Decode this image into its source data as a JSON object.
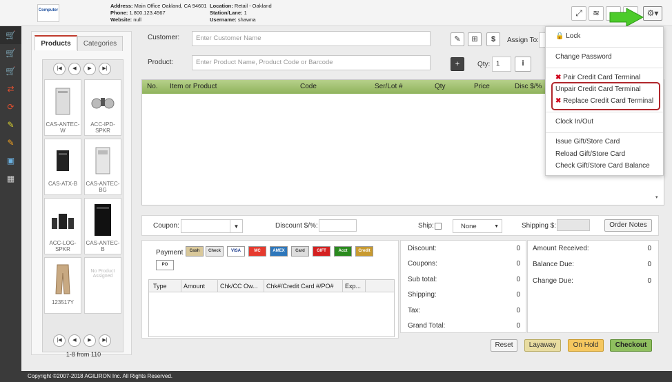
{
  "header": {
    "logo_text": "Computer",
    "address_label": "Address:",
    "address": "Main Office Oakland, CA 94601",
    "phone_label": "Phone:",
    "phone": "1.800.123.4567",
    "website_label": "Website:",
    "website": "null",
    "location_label": "Location:",
    "location": "Retail - Oakland",
    "station_label": "Station/Lane:",
    "station": "1",
    "username_label": "Username:",
    "username": "shawna"
  },
  "products_panel": {
    "tabs": [
      "Products",
      "Categories"
    ],
    "products": [
      {
        "name": "CAS-ANTEC-W"
      },
      {
        "name": "ACC-IPD-SPKR"
      },
      {
        "name": "CAS-ATX-B"
      },
      {
        "name": "CAS-ANTEC-BG"
      },
      {
        "name": "ACC-LOG-SPKR"
      },
      {
        "name": "CAS-ANTEC-B"
      },
      {
        "name": "123517Y"
      },
      {
        "name": "No Product Assigned"
      }
    ],
    "pagination_text": "1-8 from 110"
  },
  "order": {
    "customer_label": "Customer:",
    "customer_placeholder": "Enter Customer Name",
    "assign_to_label": "Assign To:",
    "product_label": "Product:",
    "product_placeholder": "Enter Product Name, Product Code or Barcode",
    "qty_label": "Qty:",
    "qty_value": "1",
    "columns": [
      "No.",
      "Item or Product",
      "Code",
      "Ser/Lot #",
      "Qty",
      "Price",
      "Disc $/%"
    ]
  },
  "options_bar": {
    "coupon_label": "Coupon:",
    "disc_label": "Discount $/%:",
    "ship_label": "Ship:",
    "ship_select": "None",
    "shipping_label": "Shipping $:",
    "order_notes": "Order Notes"
  },
  "payment": {
    "label": "Payment",
    "icons": [
      "Cash",
      "Check",
      "VISA",
      "MC",
      "AMEX",
      "Card",
      "GIFT",
      "Acct",
      "Credit",
      "PO"
    ],
    "columns": [
      "Type",
      "Amount",
      "Chk/CC Ow...",
      "Chk#/Credit Card #/PO#",
      "Exp..."
    ]
  },
  "totals": {
    "rows": [
      {
        "label": "Discount:",
        "value": "0"
      },
      {
        "label": "Coupons:",
        "value": "0"
      },
      {
        "label": "Sub total:",
        "value": "0"
      },
      {
        "label": "Shipping:",
        "value": "0"
      },
      {
        "label": "Tax:",
        "value": "0"
      },
      {
        "label": "Grand Total:",
        "value": "0"
      }
    ]
  },
  "balance": {
    "rows": [
      {
        "label": "Amount Received:",
        "value": "0"
      },
      {
        "label": "Balance Due:",
        "value": "0"
      },
      {
        "label": "Change Due:",
        "value": "0"
      }
    ]
  },
  "actions": {
    "reset": "Reset",
    "layaway": "Layaway",
    "on_hold": "On Hold",
    "checkout": "Checkout"
  },
  "settings_menu": {
    "lock": "Lock",
    "change_password": "Change Password",
    "pair_terminal": "Pair Credit Card Terminal",
    "unpair_terminal": "Unpair Credit Card Terminal",
    "replace_terminal": "Replace Credit Card Terminal",
    "clock": "Clock In/Out",
    "issue_gift": "Issue Gift/Store Card",
    "reload_gift": "Reload Gift/Store Card",
    "check_gift": "Check Gift/Store Card Balance"
  },
  "footer": {
    "copyright": "Copyright ©2007-2018 AGILIRON Inc. All Rights Reserved."
  },
  "colors": {
    "grid_header": "#9bbb6a",
    "checkout": "#8fbf5f",
    "layaway": "#e8dca0",
    "on_hold": "#f5c75f",
    "nav_dark": "#3a3a3a",
    "highlight_box": "#b0262b",
    "arrow": "#4ccb2a"
  }
}
